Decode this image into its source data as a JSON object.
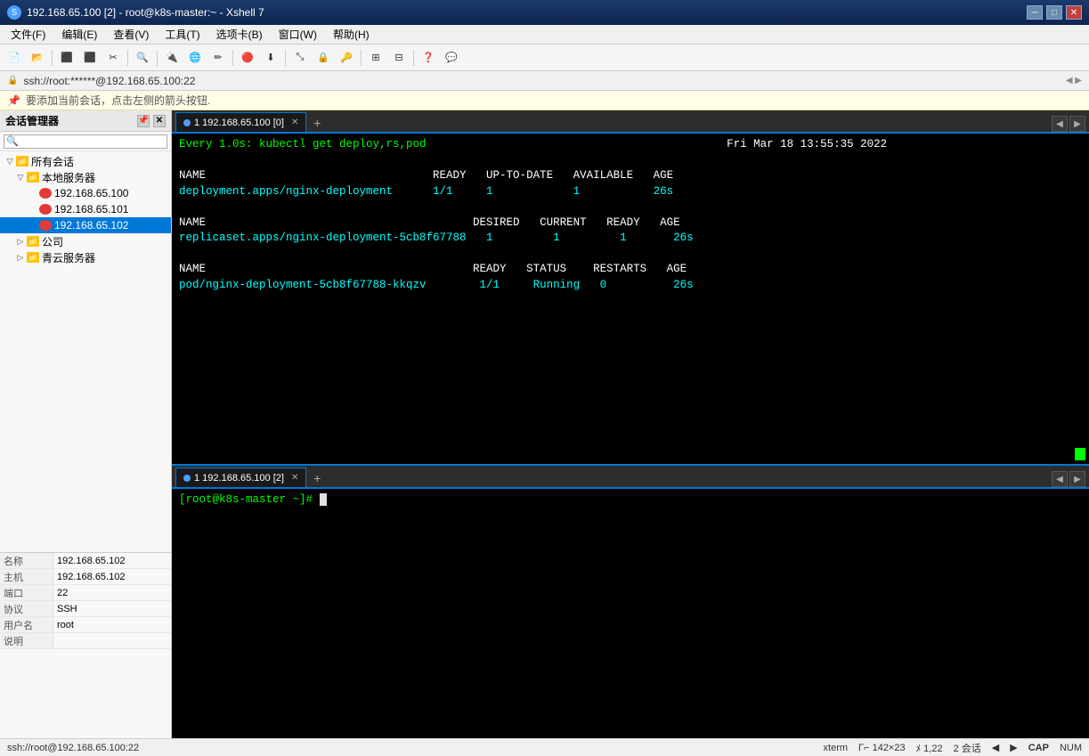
{
  "window": {
    "title": "192.168.65.100 [2] - root@k8s-master:~ - Xshell 7",
    "icon": "●"
  },
  "menubar": {
    "items": [
      "文件(F)",
      "编辑(E)",
      "查看(V)",
      "工具(T)",
      "选项卡(B)",
      "窗口(W)",
      "帮助(H)"
    ]
  },
  "address_bar": {
    "icon": "🔒",
    "text": "ssh://root:******@192.168.65.100:22"
  },
  "hint_bar": {
    "text": "要添加当前会话，点击左侧的箭头按钮."
  },
  "sidebar": {
    "title": "会话管理器",
    "tree": [
      {
        "label": "所有会话",
        "indent": 0,
        "type": "root",
        "expanded": true
      },
      {
        "label": "本地服务器",
        "indent": 1,
        "type": "folder",
        "expanded": true
      },
      {
        "label": "192.168.65.100",
        "indent": 2,
        "type": "server"
      },
      {
        "label": "192.168.65.101",
        "indent": 2,
        "type": "server"
      },
      {
        "label": "192.168.65.102",
        "indent": 2,
        "type": "server",
        "selected": true
      },
      {
        "label": "公司",
        "indent": 1,
        "type": "folder",
        "expanded": false
      },
      {
        "label": "青云服务器",
        "indent": 1,
        "type": "folder",
        "expanded": false
      }
    ]
  },
  "properties": {
    "rows": [
      {
        "key": "名称",
        "value": "192.168.65.102"
      },
      {
        "key": "主机",
        "value": "192.168.65.102"
      },
      {
        "key": "端口",
        "value": "22"
      },
      {
        "key": "协议",
        "value": "SSH"
      },
      {
        "key": "用户名",
        "value": "root"
      },
      {
        "key": "说明",
        "value": ""
      }
    ]
  },
  "tabs": {
    "top_tabs": [
      {
        "label": "1 192.168.65.100 [0]",
        "active": true
      },
      {
        "label": "+",
        "type": "add"
      }
    ],
    "bottom_tabs": [
      {
        "label": "1 192.168.65.100 [2]",
        "active": true
      },
      {
        "label": "+",
        "type": "add"
      }
    ]
  },
  "terminal_top": {
    "watch_line": "Every 1.0s: kubectl get deploy,rs,pod",
    "timestamp": "Fri Mar 18 13:55:35 2022",
    "deploy_header": "NAME                                  READY   UP-TO-DATE   AVAILABLE   AGE",
    "deploy_row": "deployment.apps/nginx-deployment      1/1     1            1           26s",
    "rs_header": "NAME                                        DESIRED   CURRENT   READY   AGE",
    "rs_row": "replicaset.apps/nginx-deployment-5cb8f67788   1         1         1       26s",
    "pod_header": "NAME                                        READY   STATUS    RESTARTS   AGE",
    "pod_row": "pod/nginx-deployment-5cb8f67788-kkqzv        1/1     Running   0          26s"
  },
  "terminal_bottom": {
    "prompt": "[root@k8s-master ~]# "
  },
  "status_bar": {
    "ssh_info": "ssh://root@192.168.65.100:22",
    "term_type": "xterm",
    "dimensions": "142×23",
    "position": "1,22",
    "sessions": "2 会话",
    "cap": "CAP",
    "num": "NUM"
  }
}
